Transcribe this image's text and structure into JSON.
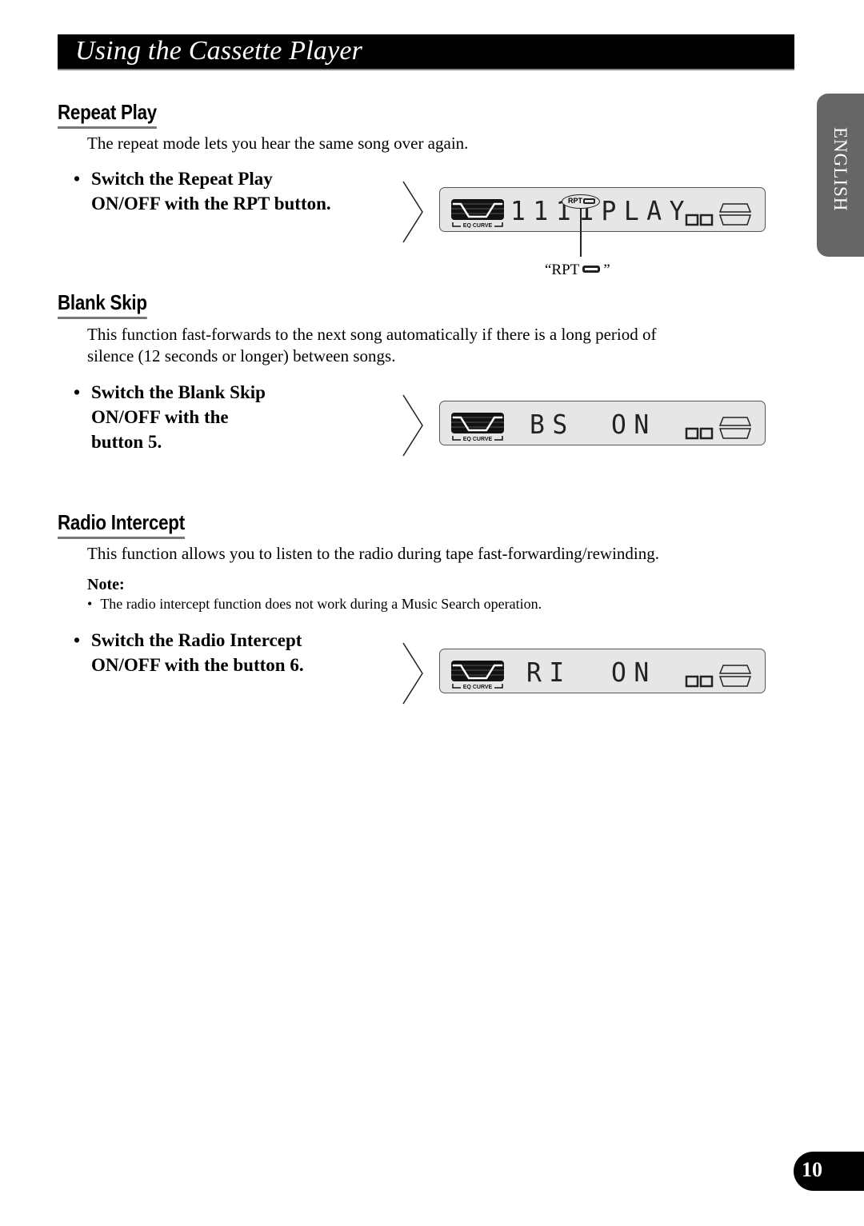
{
  "header": {
    "title": "Using the Cassette Player"
  },
  "language_tab": {
    "label": "ENGLISH"
  },
  "sections": [
    {
      "heading": "Repeat Play",
      "body": [
        "The repeat mode lets you hear the same song over again."
      ],
      "step": [
        "Switch the Repeat Play",
        "ON/OFF with the RPT button."
      ],
      "display": {
        "eq_label": "EQ CURVE",
        "text": "1111PLAY",
        "indicator": "RPT",
        "indicator_icon": "repeat-loop-icon"
      },
      "callout": {
        "open": "“RPT",
        "close": "”"
      }
    },
    {
      "heading": "Blank Skip",
      "body": [
        "This function fast-forwards to the next song automatically if there is a long period of",
        "silence (12 seconds or longer) between songs."
      ],
      "step": [
        "Switch the Blank Skip",
        "ON/OFF with the",
        "button 5."
      ],
      "display": {
        "eq_label": "EQ CURVE",
        "text_left": "BS",
        "text_right": "ON"
      }
    },
    {
      "heading": "Radio Intercept",
      "body": [
        "This function allows you to listen to the radio during tape fast-forwarding/rewinding."
      ],
      "note": {
        "label": "Note:",
        "items": [
          "The radio intercept function does not work during a Music Search operation."
        ]
      },
      "step": [
        "Switch the Radio Intercept",
        "ON/OFF with the button 6."
      ],
      "display": {
        "eq_label": "EQ CURVE",
        "text_left": "RI",
        "text_right": "ON"
      }
    }
  ],
  "footer": {
    "page_number": "10"
  },
  "bullet": "•"
}
